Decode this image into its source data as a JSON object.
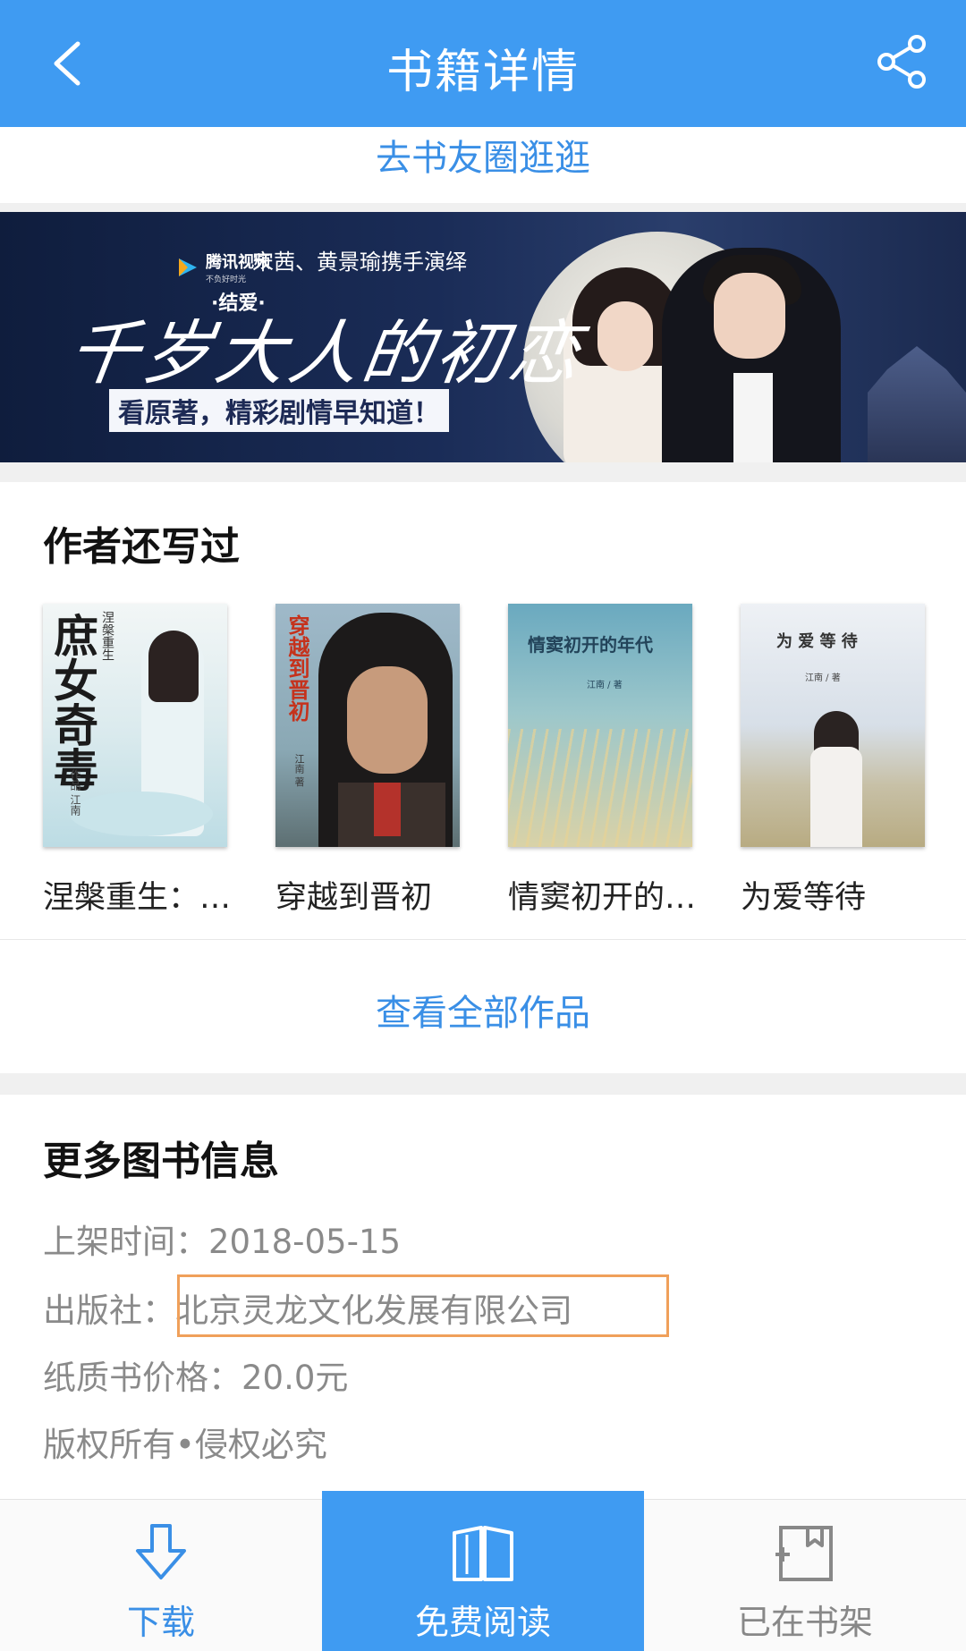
{
  "header": {
    "title": "书籍详情",
    "back_icon": "chevron-left-icon",
    "share_icon": "share-icon"
  },
  "circle_link": "去书友圈逛逛",
  "banner": {
    "brand": "腾讯视频",
    "brand_slogan": "不负好时光",
    "cast": "宋茜、黄景瑜携手演绎",
    "small_title": "·结爱·",
    "big_title": "千岁大人的初恋",
    "tagline": "看原著，精彩剧情早知道！"
  },
  "author_works": {
    "title": "作者还写过",
    "books": [
      {
        "name": "涅槃重生：…",
        "cover_title": "庶女奇毒",
        "cover_sub": "涅槃重生",
        "cover_author": "作品 江南"
      },
      {
        "name": "穿越到晋初",
        "cover_title": "穿越到晋初",
        "cover_author": "江南 著"
      },
      {
        "name": "情窦初开的…",
        "cover_title": "情窦初开的年代",
        "cover_author": "江南 / 著"
      },
      {
        "name": "为爱等待",
        "cover_title": "为 爱 等 待",
        "cover_author": "江南 / 著"
      }
    ],
    "view_all": "查看全部作品"
  },
  "more_info": {
    "title": "更多图书信息",
    "shelf_time_label": "上架时间：",
    "shelf_time": "2018-05-15",
    "publisher_label": "出版社：",
    "publisher": "北京灵龙文化发展有限公司",
    "price_label": "纸质书价格：",
    "price": "20.0元",
    "copyright": "版权所有•侵权必究"
  },
  "bottom_bar": {
    "download": "下载",
    "read": "免费阅读",
    "shelf": "已在书架"
  },
  "colors": {
    "primary": "#3f9bf2",
    "link": "#3a8fe6",
    "highlight_border": "#f0a05a"
  }
}
